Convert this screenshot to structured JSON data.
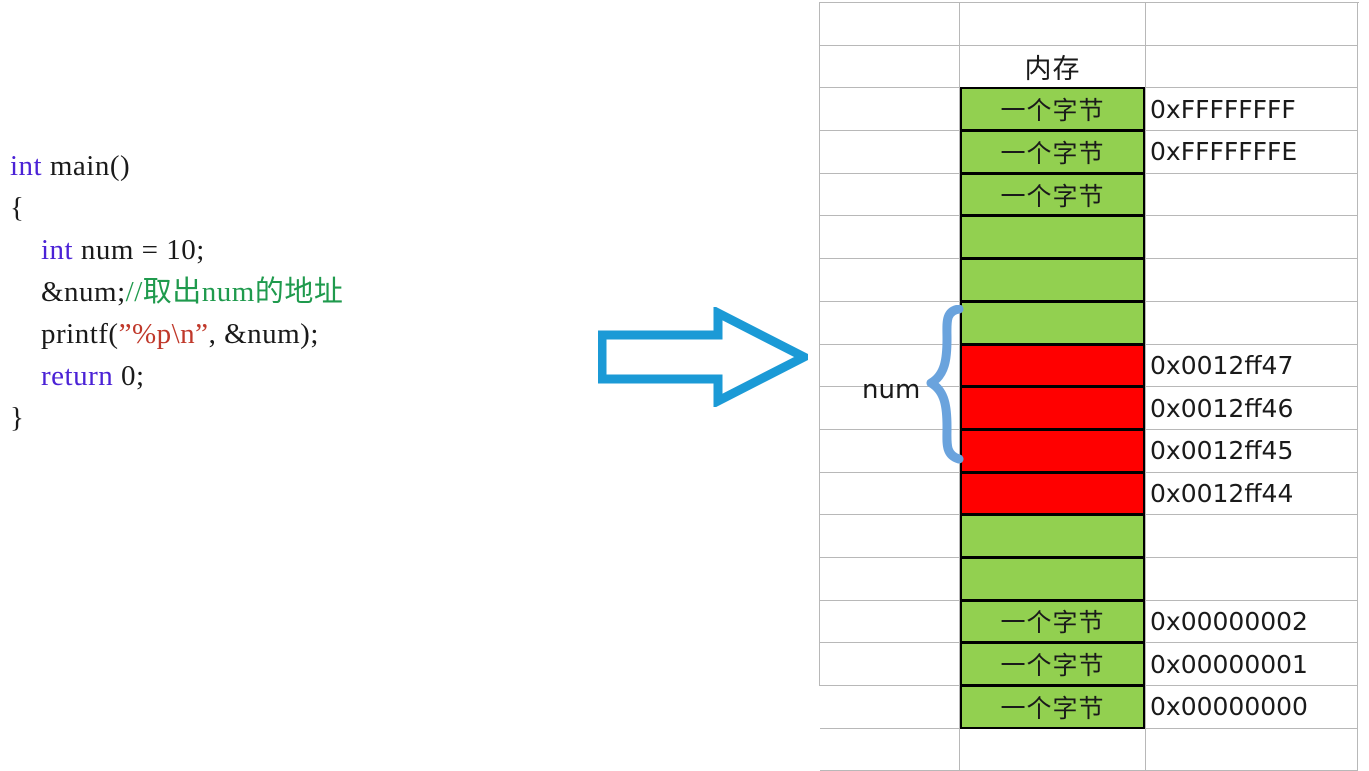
{
  "code": {
    "lines": [
      [
        {
          "t": "int",
          "c": "kw"
        },
        {
          "t": " main()",
          "c": "plain"
        }
      ],
      [
        {
          "t": "{",
          "c": "plain"
        }
      ],
      [
        {
          "t": "    ",
          "c": "plain"
        },
        {
          "t": "int",
          "c": "kw"
        },
        {
          "t": " num = 10;",
          "c": "plain"
        }
      ],
      [
        {
          "t": "    &num;",
          "c": "plain"
        },
        {
          "t": "//取出num的地址",
          "c": "comment"
        }
      ],
      [
        {
          "t": "    printf(",
          "c": "plain"
        },
        {
          "t": "”%p\\n”",
          "c": "str"
        },
        {
          "t": ", &num);",
          "c": "plain"
        }
      ],
      [
        {
          "t": "    ",
          "c": "plain"
        },
        {
          "t": "return",
          "c": "kw"
        },
        {
          "t": " 0;",
          "c": "plain"
        }
      ],
      [
        {
          "t": "}",
          "c": "plain"
        }
      ]
    ]
  },
  "arrow": {
    "name": "right-arrow",
    "color": "#1b9ad6",
    "direction": "right"
  },
  "memory": {
    "header": "内存",
    "byte_label": "一个字节",
    "variable_label": "num",
    "colors": {
      "green": "#92d050",
      "red": "#ff0000",
      "brace": "#6aa3dd",
      "gridline": "#b8b8b8"
    },
    "rows": [
      {
        "kind": "empty",
        "label": "",
        "address": ""
      },
      {
        "kind": "header",
        "label": "内存",
        "address": ""
      },
      {
        "kind": "green",
        "label": "一个字节",
        "address": "0xFFFFFFFF"
      },
      {
        "kind": "green",
        "label": "一个字节",
        "address": "0xFFFFFFFE"
      },
      {
        "kind": "green",
        "label": "一个字节",
        "address": ""
      },
      {
        "kind": "green",
        "label": "",
        "address": ""
      },
      {
        "kind": "green",
        "label": "",
        "address": ""
      },
      {
        "kind": "green",
        "label": "",
        "address": ""
      },
      {
        "kind": "red",
        "label": "",
        "address": "0x0012ff47"
      },
      {
        "kind": "red",
        "label": "",
        "address": "0x0012ff46"
      },
      {
        "kind": "red",
        "label": "",
        "address": "0x0012ff45"
      },
      {
        "kind": "red",
        "label": "",
        "address": "0x0012ff44"
      },
      {
        "kind": "green",
        "label": "",
        "address": ""
      },
      {
        "kind": "green",
        "label": "",
        "address": ""
      },
      {
        "kind": "green",
        "label": "一个字节",
        "address": "0x00000002"
      },
      {
        "kind": "green",
        "label": "一个字节",
        "address": "0x00000001"
      },
      {
        "kind": "green",
        "label": "一个字节",
        "address": "0x00000000"
      },
      {
        "kind": "empty",
        "label": "",
        "address": ""
      }
    ]
  }
}
